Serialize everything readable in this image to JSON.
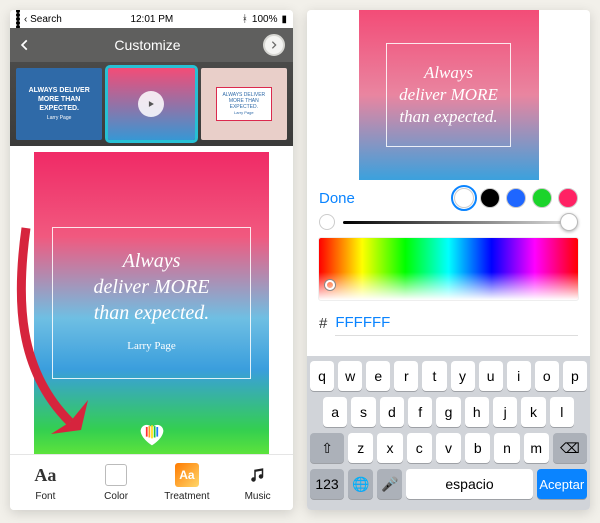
{
  "statusbar": {
    "carrier_back": "Search",
    "time": "12:01 PM",
    "bluetooth": true,
    "battery": "100%"
  },
  "header": {
    "title": "Customize"
  },
  "templates": {
    "thumb1_text": "ALWAYS DELIVER MORE THAN EXPECTED.",
    "thumb1_author": "Larry Page",
    "thumb3_text": "ALWAYS DELIVER MORE THAN EXPECTED.",
    "thumb3_author": "Larry Page"
  },
  "canvas": {
    "line1": "Always",
    "line2": "deliver MORE",
    "line3": "than expected.",
    "author": "Larry Page"
  },
  "tabs": {
    "font": "Font",
    "color": "Color",
    "treatment": "Treatment",
    "music": "Music",
    "font_glyph": "Aa",
    "treat_glyph": "Aa"
  },
  "right": {
    "preview_line1": "Always",
    "preview_line2": "deliver MORE",
    "preview_line3": "than expected.",
    "done": "Done",
    "swatches": [
      "#ffffff",
      "#000000",
      "#1e66ff",
      "#1bd42b",
      "#ff2164"
    ],
    "selected_swatch": 0,
    "slider_value_pct": 96,
    "hex_value": "FFFFFF",
    "hash": "#"
  },
  "keyboard": {
    "row1": [
      "q",
      "w",
      "e",
      "r",
      "t",
      "y",
      "u",
      "i",
      "o",
      "p"
    ],
    "row2": [
      "a",
      "s",
      "d",
      "f",
      "g",
      "h",
      "j",
      "k",
      "l"
    ],
    "row3": [
      "z",
      "x",
      "c",
      "v",
      "b",
      "n",
      "m"
    ],
    "shift": "⇧",
    "backspace": "⌫",
    "numkey": "123",
    "globe": "🌐",
    "mic": "🎤",
    "space": "espacio",
    "accept": "Aceptar"
  }
}
